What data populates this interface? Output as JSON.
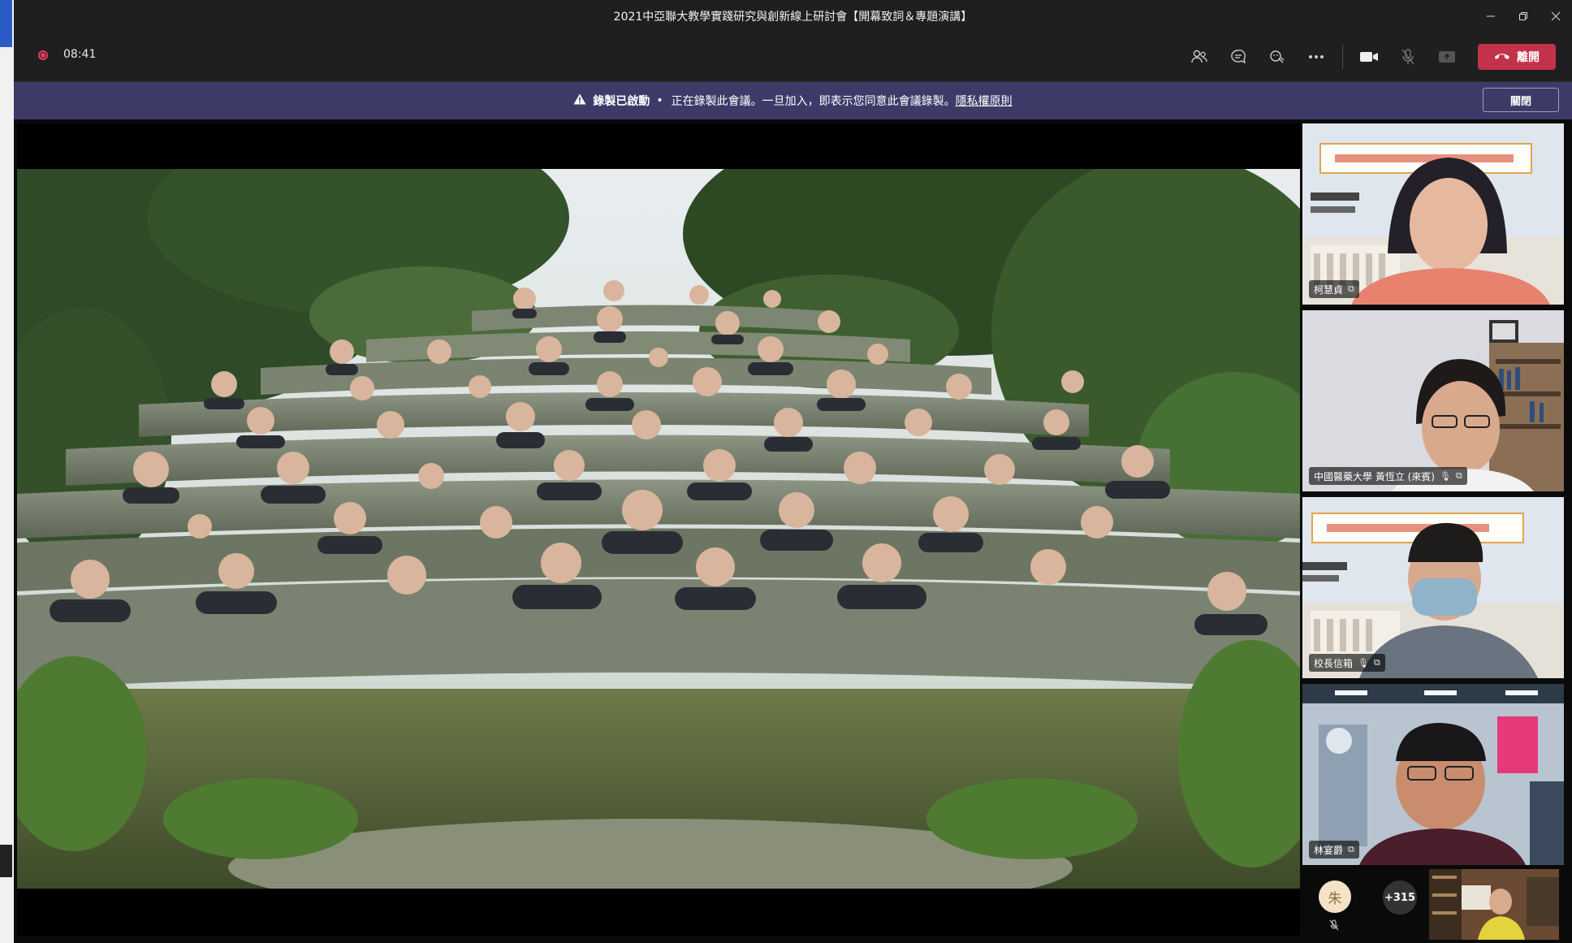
{
  "window": {
    "title": "2021中亞聯大教學實踐研究與創新線上研討會【開幕致詞＆專題演講】",
    "controls": [
      "minimize-icon",
      "restore-icon",
      "close-icon"
    ]
  },
  "toolbar": {
    "timer": "08:41",
    "icons": [
      "participants-icon",
      "chat-icon",
      "reactions-icon",
      "more-options-icon",
      "camera-icon",
      "microphone-icon",
      "share-screen-icon"
    ],
    "leave_label": "離開",
    "colors": {
      "leave": "#c4314b",
      "recording": "#e0405e"
    }
  },
  "banner": {
    "bold_text": "錄製已啟動",
    "message": "正在錄製此會議。一旦加入，即表示您同意此會議錄製。",
    "link_text": "隱私權原則",
    "close_label": "關閉",
    "color": "#3e3a68"
  },
  "participants": [
    {
      "name": "柯慧貞"
    },
    {
      "name": "中國醫藥大學 黃恆立 (來賓)"
    },
    {
      "name": "校長信箱"
    },
    {
      "name": "林宴爵"
    }
  ],
  "bottom": {
    "avatar_initial": "朱",
    "more_count": "+315"
  }
}
